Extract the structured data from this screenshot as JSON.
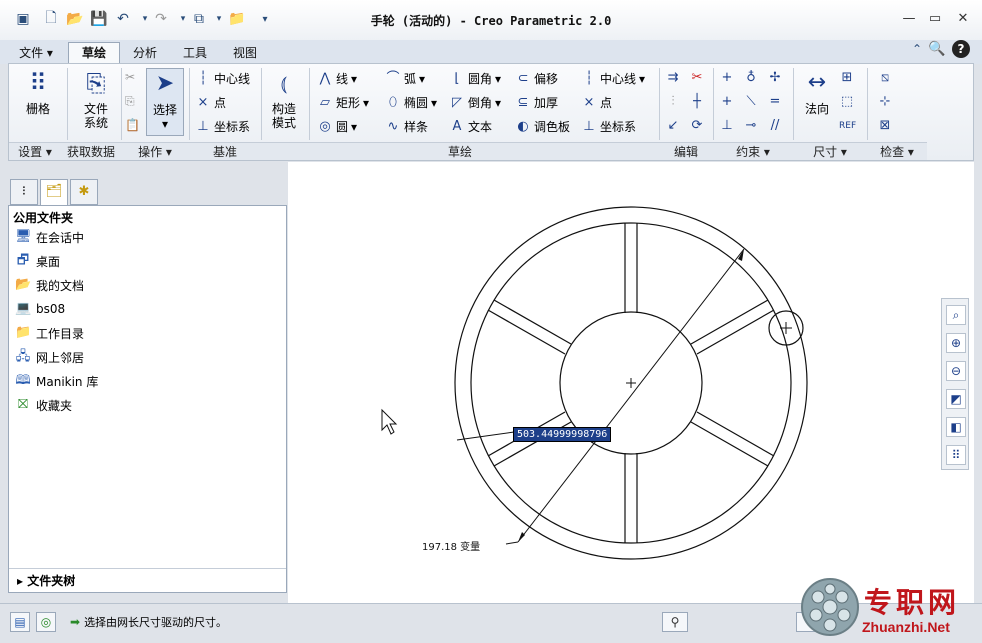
{
  "window": {
    "title": "手轮 (活动的) - Creo Parametric 2.0"
  },
  "menu_tabs": [
    {
      "label": "文件 ▾"
    },
    {
      "label": "草绘"
    },
    {
      "label": "分析"
    },
    {
      "label": "工具"
    },
    {
      "label": "视图"
    }
  ],
  "ribbon": {
    "grid_label": "栅格",
    "filesys_label1": "文件",
    "filesys_label2": "系统",
    "select_label": "选择",
    "datum": {
      "centerline": "中心线",
      "point": "点",
      "coordsys": "坐标系"
    },
    "construct_label1": "构造",
    "construct_label2": "模式",
    "sketch": {
      "line": "线",
      "rect": "矩形",
      "circle": "圆",
      "arc": "弧",
      "ellipse": "椭圆",
      "spline": "样条",
      "fillet": "圆角",
      "chamfer": "倒角",
      "text": "文本",
      "offset": "偏移",
      "thicken": "加厚",
      "palette": "调色板",
      "centerline": "中心线",
      "point": "点",
      "coordsys": "坐标系"
    },
    "normal_label": "法向",
    "groups": {
      "settings": "设置 ▾",
      "getdata": "获取数据",
      "operations": "操作 ▾",
      "datum": "基准",
      "sketching": "草绘",
      "editing": "编辑",
      "constraints": "约束 ▾",
      "dimension": "尺寸 ▾",
      "inspect": "检查 ▾"
    }
  },
  "panel": {
    "header": "公用文件夹",
    "items": [
      {
        "label": "在会话中",
        "icon": "monitor-icon"
      },
      {
        "label": "桌面",
        "icon": "desktop-icon"
      },
      {
        "label": "我的文档",
        "icon": "folder-open-icon"
      },
      {
        "label": "bs08",
        "icon": "computer-icon"
      },
      {
        "label": "工作目录",
        "icon": "folder-star-icon"
      },
      {
        "label": "网上邻居",
        "icon": "network-icon"
      },
      {
        "label": "Manikin 库",
        "icon": "library-icon"
      },
      {
        "label": "收藏夹",
        "icon": "favorites-icon"
      }
    ],
    "folder_tree": "▸ 文件夹树"
  },
  "sketch": {
    "dim_edit_value": "503.44999998796",
    "dim_label": "197.18 变量"
  },
  "status": {
    "message": "选择由网长尺寸驱动的尺寸。"
  },
  "watermark": {
    "text_cn": "专职网",
    "text_en": "Zhuanzhi.Net"
  },
  "colors": {
    "accent": "#1d3f8a",
    "ribbon_bg": "#f2f5f9",
    "watermark_red": "#c0161b"
  }
}
